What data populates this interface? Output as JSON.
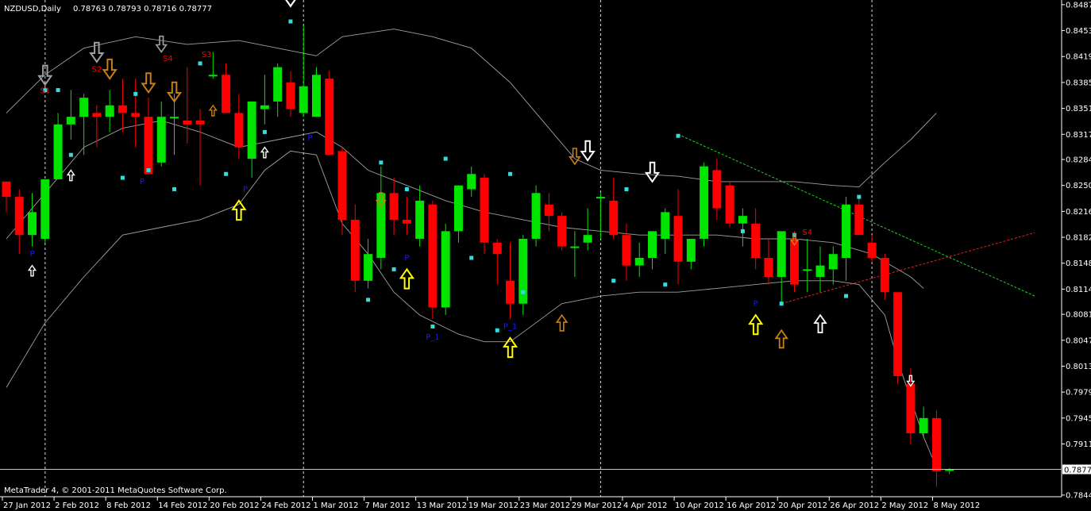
{
  "header": {
    "symbol": "NZDUSD,Daily",
    "ohlc": "0.78763 0.78793 0.78716 0.78777"
  },
  "footer": {
    "copyright": "MetaTrader 4, © 2001-2011 MetaQuotes Software Corp."
  },
  "colors": {
    "background": "#000000",
    "bull": "#00e400",
    "bear": "#ff0000",
    "bands": "#c8c8c8",
    "grid_vertical": "#ffffff",
    "current_price_line": "#c0c0c0",
    "cyan_marker": "#33dddd",
    "green_trend": "#1fd31f",
    "red_trend": "#e02020",
    "arrow_white": "#ffffff",
    "arrow_yellow": "#ffff00",
    "arrow_orange": "#c87f15",
    "arrow_gray": "#a0a0a0",
    "blue_label": "#1a1aff"
  },
  "chart_data": {
    "type": "candlestick",
    "symbol": "NZDUSD",
    "timeframe": "Daily",
    "ylim": [
      0.7846,
      0.849
    ],
    "y_ticks": [
      "0.84870",
      "0.84530",
      "0.84190",
      "0.83850",
      "0.83510",
      "0.83170",
      "0.82840",
      "0.82500",
      "0.82160",
      "0.81820",
      "0.81480",
      "0.81140",
      "0.80810",
      "0.80470",
      "0.80130",
      "0.79790",
      "0.79450",
      "0.79110",
      "0.78777",
      "0.78440"
    ],
    "current_price": 0.78777,
    "x_tick_labels": [
      "27 Jan 2012",
      "2 Feb 2012",
      "8 Feb 2012",
      "14 Feb 2012",
      "20 Feb 2012",
      "24 Feb 2012",
      "1 Mar 2012",
      "7 Mar 2012",
      "13 Mar 2012",
      "19 Mar 2012",
      "23 Mar 2012",
      "29 Mar 2012",
      "4 Apr 2012",
      "10 Apr 2012",
      "16 Apr 2012",
      "20 Apr 2012",
      "26 Apr 2012",
      "2 May 2012",
      "8 May 2012"
    ],
    "x_tick_positions": [
      0,
      4,
      8,
      12,
      16,
      20,
      24,
      28,
      32,
      36,
      40,
      44,
      48,
      52,
      56,
      60,
      64,
      68,
      72
    ],
    "period_separators": [
      3,
      23,
      46,
      67
    ],
    "candles": [
      [
        0.8255,
        0.8255,
        0.8215,
        0.8235
      ],
      [
        0.8235,
        0.8245,
        0.816,
        0.8185
      ],
      [
        0.8185,
        0.824,
        0.817,
        0.8215
      ],
      [
        0.818,
        0.8255,
        0.8175,
        0.8258
      ],
      [
        0.8258,
        0.8345,
        0.8258,
        0.833
      ],
      [
        0.833,
        0.8375,
        0.831,
        0.834
      ],
      [
        0.834,
        0.837,
        0.829,
        0.8365
      ],
      [
        0.8345,
        0.8355,
        0.83,
        0.834
      ],
      [
        0.834,
        0.8375,
        0.832,
        0.8355
      ],
      [
        0.8355,
        0.839,
        0.832,
        0.8345
      ],
      [
        0.8345,
        0.839,
        0.83,
        0.834
      ],
      [
        0.834,
        0.8365,
        0.8265,
        0.8265
      ],
      [
        0.828,
        0.836,
        0.8275,
        0.834
      ],
      [
        0.834,
        0.837,
        0.829,
        0.834
      ],
      [
        0.8335,
        0.8405,
        0.8305,
        0.833
      ],
      [
        0.8335,
        0.835,
        0.825,
        0.833
      ],
      [
        0.8395,
        0.8425,
        0.839,
        0.8395
      ],
      [
        0.8395,
        0.841,
        0.835,
        0.8345
      ],
      [
        0.8345,
        0.837,
        0.8285,
        0.83
      ],
      [
        0.8285,
        0.836,
        0.826,
        0.836
      ],
      [
        0.835,
        0.8395,
        0.833,
        0.8355
      ],
      [
        0.836,
        0.841,
        0.834,
        0.8405
      ],
      [
        0.8385,
        0.84,
        0.834,
        0.835
      ],
      [
        0.8345,
        0.846,
        0.834,
        0.838
      ],
      [
        0.834,
        0.8405,
        0.834,
        0.8395
      ],
      [
        0.839,
        0.84,
        0.8295,
        0.829
      ],
      [
        0.8295,
        0.83,
        0.8185,
        0.8205
      ],
      [
        0.8205,
        0.8225,
        0.811,
        0.8125
      ],
      [
        0.8125,
        0.818,
        0.8115,
        0.816
      ],
      [
        0.8155,
        0.8275,
        0.814,
        0.824
      ],
      [
        0.824,
        0.826,
        0.8185,
        0.8205
      ],
      [
        0.8205,
        0.8235,
        0.8185,
        0.82
      ],
      [
        0.818,
        0.825,
        0.817,
        0.823
      ],
      [
        0.8225,
        0.823,
        0.8075,
        0.809
      ],
      [
        0.809,
        0.82,
        0.808,
        0.819
      ],
      [
        0.819,
        0.825,
        0.8175,
        0.825
      ],
      [
        0.8245,
        0.8275,
        0.8235,
        0.8265
      ],
      [
        0.826,
        0.8265,
        0.816,
        0.8175
      ],
      [
        0.8175,
        0.818,
        0.812,
        0.816
      ],
      [
        0.8125,
        0.8175,
        0.8075,
        0.8095
      ],
      [
        0.8095,
        0.8185,
        0.808,
        0.818
      ],
      [
        0.818,
        0.825,
        0.817,
        0.824
      ],
      [
        0.8225,
        0.824,
        0.819,
        0.821
      ],
      [
        0.821,
        0.8215,
        0.8165,
        0.817
      ],
      [
        0.817,
        0.819,
        0.813,
        0.817
      ],
      [
        0.8175,
        0.822,
        0.8165,
        0.8185
      ],
      [
        0.8235,
        0.824,
        0.818,
        0.8235
      ],
      [
        0.823,
        0.826,
        0.818,
        0.8185
      ],
      [
        0.8185,
        0.82,
        0.8125,
        0.8145
      ],
      [
        0.8145,
        0.8175,
        0.813,
        0.8155
      ],
      [
        0.8155,
        0.819,
        0.814,
        0.819
      ],
      [
        0.818,
        0.822,
        0.816,
        0.8215
      ],
      [
        0.821,
        0.8245,
        0.812,
        0.815
      ],
      [
        0.815,
        0.818,
        0.814,
        0.818
      ],
      [
        0.818,
        0.828,
        0.817,
        0.8275
      ],
      [
        0.827,
        0.8285,
        0.8205,
        0.822
      ],
      [
        0.825,
        0.8255,
        0.8195,
        0.82
      ],
      [
        0.82,
        0.822,
        0.817,
        0.821
      ],
      [
        0.82,
        0.822,
        0.814,
        0.8155
      ],
      [
        0.8155,
        0.818,
        0.812,
        0.813
      ],
      [
        0.813,
        0.8185,
        0.8095,
        0.819
      ],
      [
        0.818,
        0.819,
        0.811,
        0.812
      ],
      [
        0.814,
        0.818,
        0.811,
        0.814
      ],
      [
        0.813,
        0.817,
        0.811,
        0.8145
      ],
      [
        0.814,
        0.817,
        0.812,
        0.816
      ],
      [
        0.8155,
        0.8235,
        0.8125,
        0.8225
      ],
      [
        0.8225,
        0.8235,
        0.8185,
        0.8185
      ],
      [
        0.8175,
        0.8185,
        0.815,
        0.8155
      ],
      [
        0.8155,
        0.816,
        0.81,
        0.811
      ],
      [
        0.811,
        0.8105,
        0.799,
        0.8
      ],
      [
        0.799,
        0.801,
        0.791,
        0.7925
      ],
      [
        0.7925,
        0.796,
        0.792,
        0.7945
      ],
      [
        0.7945,
        0.7955,
        0.7855,
        0.7875
      ],
      [
        0.78763,
        0.78793,
        0.78716,
        0.78777
      ]
    ],
    "bands": {
      "upper": [
        [
          0,
          0.8345
        ],
        [
          3,
          0.8395
        ],
        [
          6,
          0.843
        ],
        [
          10,
          0.8445
        ],
        [
          14,
          0.8435
        ],
        [
          18,
          0.844
        ],
        [
          21,
          0.843
        ],
        [
          24,
          0.842
        ],
        [
          26,
          0.8445
        ],
        [
          30,
          0.8455
        ],
        [
          33,
          0.8445
        ],
        [
          36,
          0.843
        ],
        [
          39,
          0.8385
        ],
        [
          42,
          0.8325
        ],
        [
          44,
          0.8285
        ],
        [
          46,
          0.827
        ],
        [
          49,
          0.8265
        ],
        [
          52,
          0.8262
        ],
        [
          55,
          0.8255
        ],
        [
          58,
          0.8255
        ],
        [
          61,
          0.8255
        ],
        [
          64,
          0.825
        ],
        [
          66,
          0.8248
        ],
        [
          68,
          0.828
        ],
        [
          70,
          0.831
        ],
        [
          72,
          0.8345
        ]
      ],
      "middle": [
        [
          0,
          0.818
        ],
        [
          3,
          0.824
        ],
        [
          6,
          0.83
        ],
        [
          9,
          0.8325
        ],
        [
          12,
          0.8335
        ],
        [
          15,
          0.832
        ],
        [
          18,
          0.83
        ],
        [
          21,
          0.831
        ],
        [
          24,
          0.832
        ],
        [
          26,
          0.83
        ],
        [
          28,
          0.827
        ],
        [
          31,
          0.825
        ],
        [
          34,
          0.823
        ],
        [
          37,
          0.8215
        ],
        [
          40,
          0.8205
        ],
        [
          43,
          0.8195
        ],
        [
          46,
          0.819
        ],
        [
          49,
          0.8185
        ],
        [
          52,
          0.8185
        ],
        [
          55,
          0.8185
        ],
        [
          58,
          0.818
        ],
        [
          61,
          0.818
        ],
        [
          64,
          0.8175
        ],
        [
          67,
          0.816
        ],
        [
          70,
          0.813
        ],
        [
          71,
          0.8115
        ]
      ],
      "lower": [
        [
          0,
          0.7985
        ],
        [
          3,
          0.807
        ],
        [
          6,
          0.813
        ],
        [
          9,
          0.8185
        ],
        [
          12,
          0.8195
        ],
        [
          15,
          0.8205
        ],
        [
          18,
          0.8225
        ],
        [
          20,
          0.827
        ],
        [
          22,
          0.8295
        ],
        [
          24,
          0.829
        ],
        [
          26,
          0.82
        ],
        [
          28,
          0.816
        ],
        [
          30,
          0.811
        ],
        [
          32,
          0.808
        ],
        [
          35,
          0.8055
        ],
        [
          37,
          0.8045
        ],
        [
          39,
          0.8045
        ],
        [
          41,
          0.807
        ],
        [
          43,
          0.8095
        ],
        [
          46,
          0.8105
        ],
        [
          49,
          0.811
        ],
        [
          52,
          0.811
        ],
        [
          55,
          0.8115
        ],
        [
          58,
          0.812
        ],
        [
          61,
          0.8125
        ],
        [
          64,
          0.8125
        ],
        [
          66,
          0.812
        ],
        [
          68,
          0.808
        ],
        [
          69,
          0.802
        ],
        [
          71,
          0.792
        ],
        [
          72,
          0.788
        ]
      ]
    },
    "trendlines": [
      {
        "color_key": "green_trend",
        "from": [
          52,
          0.8317
        ],
        "to": [
          79.6,
          0.8105
        ]
      },
      {
        "color_key": "red_trend",
        "from": [
          60,
          0.8095
        ],
        "to": [
          79.6,
          0.8188
        ]
      }
    ],
    "cyan_markers": [
      [
        3,
        0.8375
      ],
      [
        4,
        0.8375
      ],
      [
        5,
        0.829
      ],
      [
        9,
        0.826
      ],
      [
        10,
        0.837
      ],
      [
        11,
        0.827
      ],
      [
        13,
        0.8245
      ],
      [
        15,
        0.841
      ],
      [
        17,
        0.8265
      ],
      [
        20,
        0.832
      ],
      [
        22,
        0.8465
      ],
      [
        28,
        0.81
      ],
      [
        29,
        0.828
      ],
      [
        30,
        0.814
      ],
      [
        31,
        0.8245
      ],
      [
        33,
        0.8065
      ],
      [
        34,
        0.8285
      ],
      [
        36,
        0.8155
      ],
      [
        38,
        0.806
      ],
      [
        39,
        0.8265
      ],
      [
        40,
        0.811
      ],
      [
        47,
        0.8125
      ],
      [
        48,
        0.8245
      ],
      [
        51,
        0.812
      ],
      [
        52,
        0.8315
      ],
      [
        57,
        0.819
      ],
      [
        60,
        0.8095
      ],
      [
        61,
        0.8185
      ],
      [
        65,
        0.8105
      ],
      [
        66,
        0.8235
      ]
    ],
    "arrows": [
      {
        "x": 3,
        "price": 0.8382,
        "dir": "down",
        "color_key": "arrow_gray",
        "size": 1.1
      },
      {
        "x": 7,
        "price": 0.8412,
        "dir": "down",
        "color_key": "arrow_gray",
        "size": 1.1
      },
      {
        "x": 8,
        "price": 0.839,
        "dir": "down",
        "color_key": "arrow_orange",
        "size": 1.1
      },
      {
        "x": 11,
        "price": 0.8372,
        "dir": "down",
        "color_key": "arrow_orange",
        "size": 1.1
      },
      {
        "x": 12,
        "price": 0.8425,
        "dir": "down",
        "color_key": "arrow_gray",
        "size": 0.9
      },
      {
        "x": 13,
        "price": 0.836,
        "dir": "down",
        "color_key": "arrow_orange",
        "size": 1.1
      },
      {
        "x": 22,
        "price": 0.8485,
        "dir": "down",
        "color_key": "arrow_white",
        "size": 1.2
      },
      {
        "x": 29,
        "price": 0.8222,
        "dir": "down",
        "color_key": "arrow_orange",
        "size": 0.8
      },
      {
        "x": 44,
        "price": 0.8278,
        "dir": "down",
        "color_key": "arrow_orange",
        "size": 0.9
      },
      {
        "x": 45,
        "price": 0.8283,
        "dir": "down",
        "color_key": "arrow_white",
        "size": 1.1
      },
      {
        "x": 50,
        "price": 0.8255,
        "dir": "down",
        "color_key": "arrow_white",
        "size": 1.1
      },
      {
        "x": 61,
        "price": 0.8172,
        "dir": "down",
        "color_key": "arrow_orange",
        "size": 0.6
      },
      {
        "x": 70,
        "price": 0.7987,
        "dir": "down",
        "color_key": "arrow_white",
        "size": 0.6
      },
      {
        "x": 2,
        "price": 0.8145,
        "dir": "up",
        "color_key": "arrow_white",
        "size": 0.6
      },
      {
        "x": 5,
        "price": 0.827,
        "dir": "up",
        "color_key": "arrow_white",
        "size": 0.6
      },
      {
        "x": 16,
        "price": 0.8355,
        "dir": "up",
        "color_key": "arrow_orange",
        "size": 0.6
      },
      {
        "x": 18,
        "price": 0.823,
        "dir": "up",
        "color_key": "arrow_yellow",
        "size": 1.1
      },
      {
        "x": 20,
        "price": 0.83,
        "dir": "up",
        "color_key": "arrow_white",
        "size": 0.6
      },
      {
        "x": 31,
        "price": 0.814,
        "dir": "up",
        "color_key": "arrow_yellow",
        "size": 1.1
      },
      {
        "x": 39,
        "price": 0.805,
        "dir": "up",
        "color_key": "arrow_yellow",
        "size": 1.1
      },
      {
        "x": 43,
        "price": 0.808,
        "dir": "up",
        "color_key": "arrow_orange",
        "size": 0.9
      },
      {
        "x": 58,
        "price": 0.808,
        "dir": "up",
        "color_key": "arrow_yellow",
        "size": 1.1
      },
      {
        "x": 60,
        "price": 0.806,
        "dir": "up",
        "color_key": "arrow_orange",
        "size": 1.0
      },
      {
        "x": 63,
        "price": 0.808,
        "dir": "up",
        "color_key": "arrow_white",
        "size": 1.0
      }
    ],
    "text_labels": [
      {
        "x": 3,
        "price": 0.8371,
        "text": "S1",
        "color_key": "bear"
      },
      {
        "x": 7,
        "price": 0.8399,
        "text": "S2",
        "color_key": "bear"
      },
      {
        "x": 12.5,
        "price": 0.8413,
        "text": "S4",
        "color_key": "bear"
      },
      {
        "x": 15.5,
        "price": 0.8418,
        "text": "S3",
        "color_key": "bear"
      },
      {
        "x": 62,
        "price": 0.8185,
        "text": "S4",
        "color_key": "bear"
      },
      {
        "x": 2,
        "price": 0.8157,
        "text": "P",
        "color_key": "blue_label"
      },
      {
        "x": 10.5,
        "price": 0.8252,
        "text": "P",
        "color_key": "blue_label"
      },
      {
        "x": 18.5,
        "price": 0.8242,
        "text": "P",
        "color_key": "blue_label"
      },
      {
        "x": 23.5,
        "price": 0.8309,
        "text": "P",
        "color_key": "blue_label"
      },
      {
        "x": 31,
        "price": 0.8152,
        "text": "P",
        "color_key": "blue_label"
      },
      {
        "x": 33,
        "price": 0.8048,
        "text": "P_1",
        "color_key": "blue_label"
      },
      {
        "x": 39,
        "price": 0.8062,
        "text": "P_1",
        "color_key": "blue_label"
      },
      {
        "x": 58,
        "price": 0.8092,
        "text": "P",
        "color_key": "blue_label"
      }
    ]
  }
}
